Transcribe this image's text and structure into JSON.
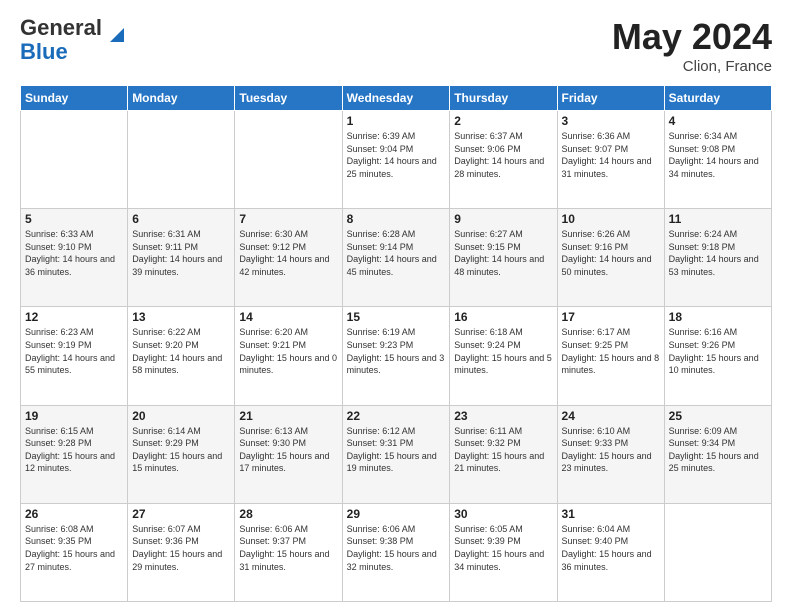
{
  "logo": {
    "general": "General",
    "blue": "Blue"
  },
  "header": {
    "month_year": "May 2024",
    "location": "Clion, France"
  },
  "days_of_week": [
    "Sunday",
    "Monday",
    "Tuesday",
    "Wednesday",
    "Thursday",
    "Friday",
    "Saturday"
  ],
  "weeks": [
    [
      {
        "day": "",
        "sunrise": "",
        "sunset": "",
        "daylight": ""
      },
      {
        "day": "",
        "sunrise": "",
        "sunset": "",
        "daylight": ""
      },
      {
        "day": "",
        "sunrise": "",
        "sunset": "",
        "daylight": ""
      },
      {
        "day": "1",
        "sunrise": "Sunrise: 6:39 AM",
        "sunset": "Sunset: 9:04 PM",
        "daylight": "Daylight: 14 hours and 25 minutes."
      },
      {
        "day": "2",
        "sunrise": "Sunrise: 6:37 AM",
        "sunset": "Sunset: 9:06 PM",
        "daylight": "Daylight: 14 hours and 28 minutes."
      },
      {
        "day": "3",
        "sunrise": "Sunrise: 6:36 AM",
        "sunset": "Sunset: 9:07 PM",
        "daylight": "Daylight: 14 hours and 31 minutes."
      },
      {
        "day": "4",
        "sunrise": "Sunrise: 6:34 AM",
        "sunset": "Sunset: 9:08 PM",
        "daylight": "Daylight: 14 hours and 34 minutes."
      }
    ],
    [
      {
        "day": "5",
        "sunrise": "Sunrise: 6:33 AM",
        "sunset": "Sunset: 9:10 PM",
        "daylight": "Daylight: 14 hours and 36 minutes."
      },
      {
        "day": "6",
        "sunrise": "Sunrise: 6:31 AM",
        "sunset": "Sunset: 9:11 PM",
        "daylight": "Daylight: 14 hours and 39 minutes."
      },
      {
        "day": "7",
        "sunrise": "Sunrise: 6:30 AM",
        "sunset": "Sunset: 9:12 PM",
        "daylight": "Daylight: 14 hours and 42 minutes."
      },
      {
        "day": "8",
        "sunrise": "Sunrise: 6:28 AM",
        "sunset": "Sunset: 9:14 PM",
        "daylight": "Daylight: 14 hours and 45 minutes."
      },
      {
        "day": "9",
        "sunrise": "Sunrise: 6:27 AM",
        "sunset": "Sunset: 9:15 PM",
        "daylight": "Daylight: 14 hours and 48 minutes."
      },
      {
        "day": "10",
        "sunrise": "Sunrise: 6:26 AM",
        "sunset": "Sunset: 9:16 PM",
        "daylight": "Daylight: 14 hours and 50 minutes."
      },
      {
        "day": "11",
        "sunrise": "Sunrise: 6:24 AM",
        "sunset": "Sunset: 9:18 PM",
        "daylight": "Daylight: 14 hours and 53 minutes."
      }
    ],
    [
      {
        "day": "12",
        "sunrise": "Sunrise: 6:23 AM",
        "sunset": "Sunset: 9:19 PM",
        "daylight": "Daylight: 14 hours and 55 minutes."
      },
      {
        "day": "13",
        "sunrise": "Sunrise: 6:22 AM",
        "sunset": "Sunset: 9:20 PM",
        "daylight": "Daylight: 14 hours and 58 minutes."
      },
      {
        "day": "14",
        "sunrise": "Sunrise: 6:20 AM",
        "sunset": "Sunset: 9:21 PM",
        "daylight": "Daylight: 15 hours and 0 minutes."
      },
      {
        "day": "15",
        "sunrise": "Sunrise: 6:19 AM",
        "sunset": "Sunset: 9:23 PM",
        "daylight": "Daylight: 15 hours and 3 minutes."
      },
      {
        "day": "16",
        "sunrise": "Sunrise: 6:18 AM",
        "sunset": "Sunset: 9:24 PM",
        "daylight": "Daylight: 15 hours and 5 minutes."
      },
      {
        "day": "17",
        "sunrise": "Sunrise: 6:17 AM",
        "sunset": "Sunset: 9:25 PM",
        "daylight": "Daylight: 15 hours and 8 minutes."
      },
      {
        "day": "18",
        "sunrise": "Sunrise: 6:16 AM",
        "sunset": "Sunset: 9:26 PM",
        "daylight": "Daylight: 15 hours and 10 minutes."
      }
    ],
    [
      {
        "day": "19",
        "sunrise": "Sunrise: 6:15 AM",
        "sunset": "Sunset: 9:28 PM",
        "daylight": "Daylight: 15 hours and 12 minutes."
      },
      {
        "day": "20",
        "sunrise": "Sunrise: 6:14 AM",
        "sunset": "Sunset: 9:29 PM",
        "daylight": "Daylight: 15 hours and 15 minutes."
      },
      {
        "day": "21",
        "sunrise": "Sunrise: 6:13 AM",
        "sunset": "Sunset: 9:30 PM",
        "daylight": "Daylight: 15 hours and 17 minutes."
      },
      {
        "day": "22",
        "sunrise": "Sunrise: 6:12 AM",
        "sunset": "Sunset: 9:31 PM",
        "daylight": "Daylight: 15 hours and 19 minutes."
      },
      {
        "day": "23",
        "sunrise": "Sunrise: 6:11 AM",
        "sunset": "Sunset: 9:32 PM",
        "daylight": "Daylight: 15 hours and 21 minutes."
      },
      {
        "day": "24",
        "sunrise": "Sunrise: 6:10 AM",
        "sunset": "Sunset: 9:33 PM",
        "daylight": "Daylight: 15 hours and 23 minutes."
      },
      {
        "day": "25",
        "sunrise": "Sunrise: 6:09 AM",
        "sunset": "Sunset: 9:34 PM",
        "daylight": "Daylight: 15 hours and 25 minutes."
      }
    ],
    [
      {
        "day": "26",
        "sunrise": "Sunrise: 6:08 AM",
        "sunset": "Sunset: 9:35 PM",
        "daylight": "Daylight: 15 hours and 27 minutes."
      },
      {
        "day": "27",
        "sunrise": "Sunrise: 6:07 AM",
        "sunset": "Sunset: 9:36 PM",
        "daylight": "Daylight: 15 hours and 29 minutes."
      },
      {
        "day": "28",
        "sunrise": "Sunrise: 6:06 AM",
        "sunset": "Sunset: 9:37 PM",
        "daylight": "Daylight: 15 hours and 31 minutes."
      },
      {
        "day": "29",
        "sunrise": "Sunrise: 6:06 AM",
        "sunset": "Sunset: 9:38 PM",
        "daylight": "Daylight: 15 hours and 32 minutes."
      },
      {
        "day": "30",
        "sunrise": "Sunrise: 6:05 AM",
        "sunset": "Sunset: 9:39 PM",
        "daylight": "Daylight: 15 hours and 34 minutes."
      },
      {
        "day": "31",
        "sunrise": "Sunrise: 6:04 AM",
        "sunset": "Sunset: 9:40 PM",
        "daylight": "Daylight: 15 hours and 36 minutes."
      },
      {
        "day": "",
        "sunrise": "",
        "sunset": "",
        "daylight": ""
      }
    ]
  ]
}
